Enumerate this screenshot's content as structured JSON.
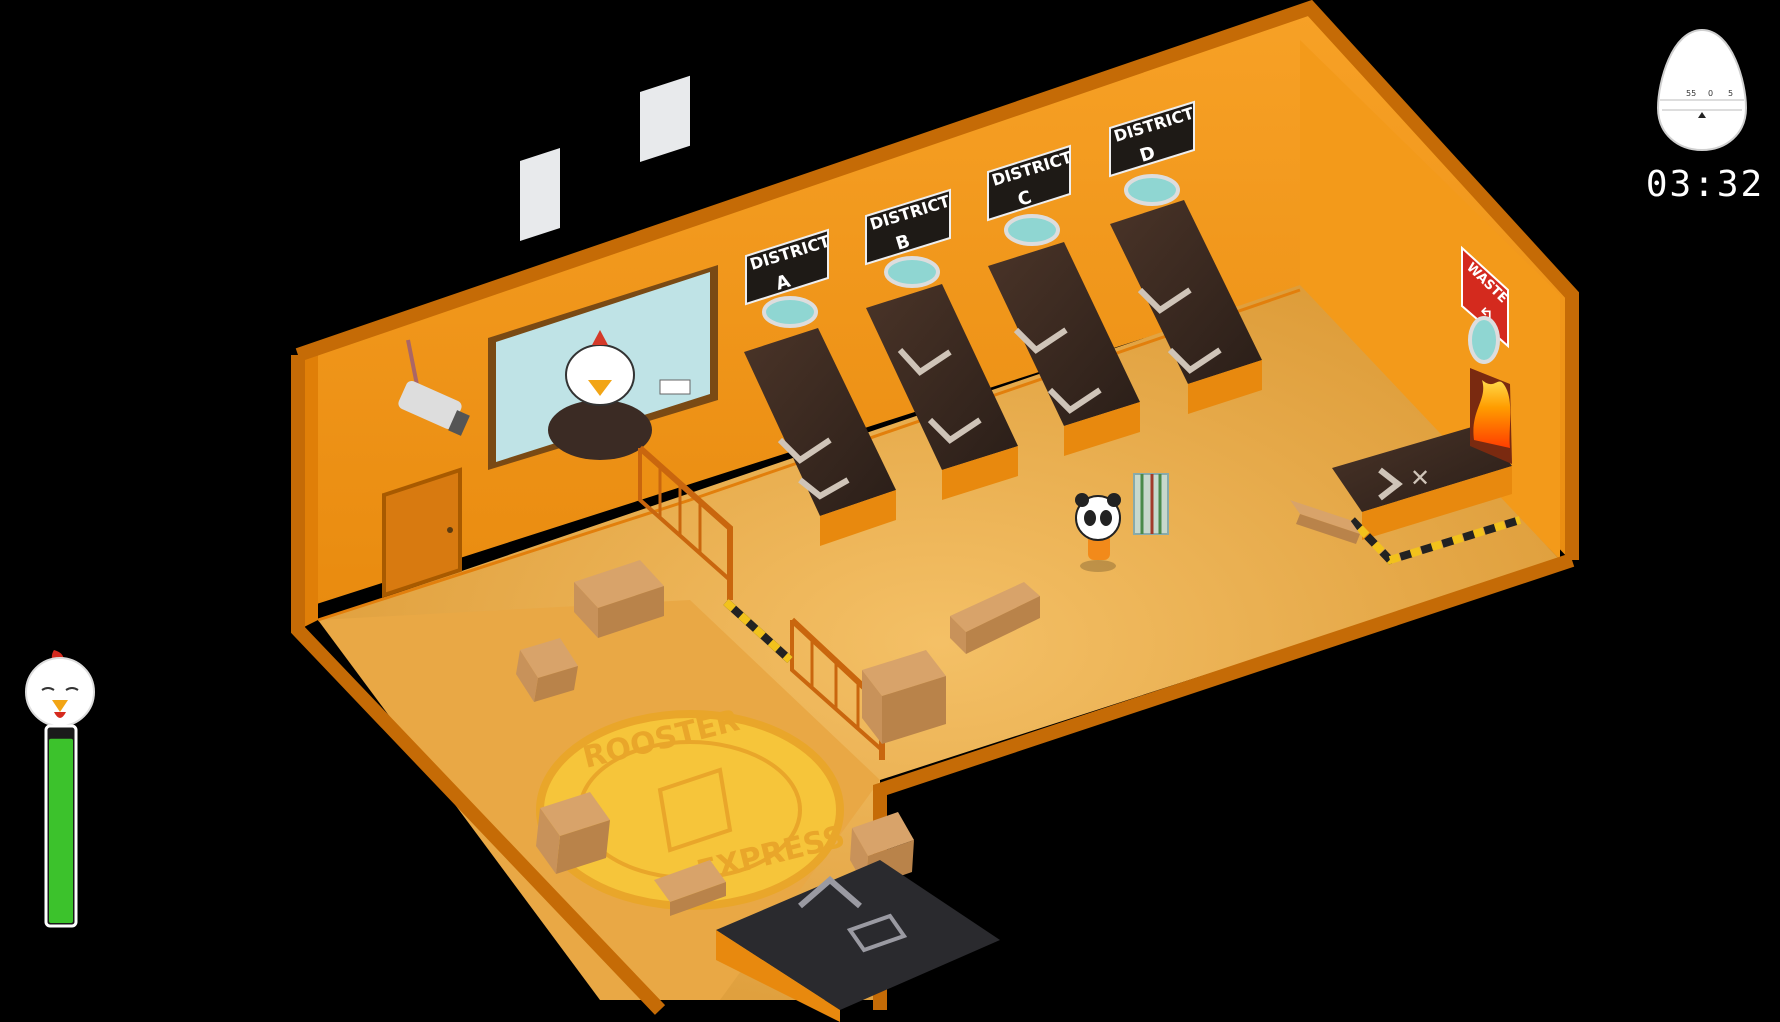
{
  "hud": {
    "timer_text": "03:32",
    "egg_timer_ticks": [
      "55",
      "0",
      "5"
    ],
    "health_level": 0.95,
    "colors": {
      "health": "#3cc22c",
      "egg": "#ffffff"
    },
    "icons": {
      "health": "chicken-head-icon",
      "timer": "egg-timer-icon"
    }
  },
  "signs": {
    "district_a": [
      "DISTRICT",
      "A"
    ],
    "district_b": [
      "DISTRICT",
      "B"
    ],
    "district_c": [
      "DISTRICT",
      "C"
    ],
    "district_d": [
      "DISTRICT",
      "D"
    ],
    "waste": "WASTE"
  },
  "floor_emblem": {
    "top_text": "ROOSTER",
    "bottom_text": "EXPRESS"
  },
  "colors": {
    "wall": "#f09212",
    "wall_dark": "#c96f08",
    "floor": "#f0b54a",
    "conveyor": "#3a2b22",
    "sign": "#1e1a16",
    "emblem": "#f6c53a"
  }
}
